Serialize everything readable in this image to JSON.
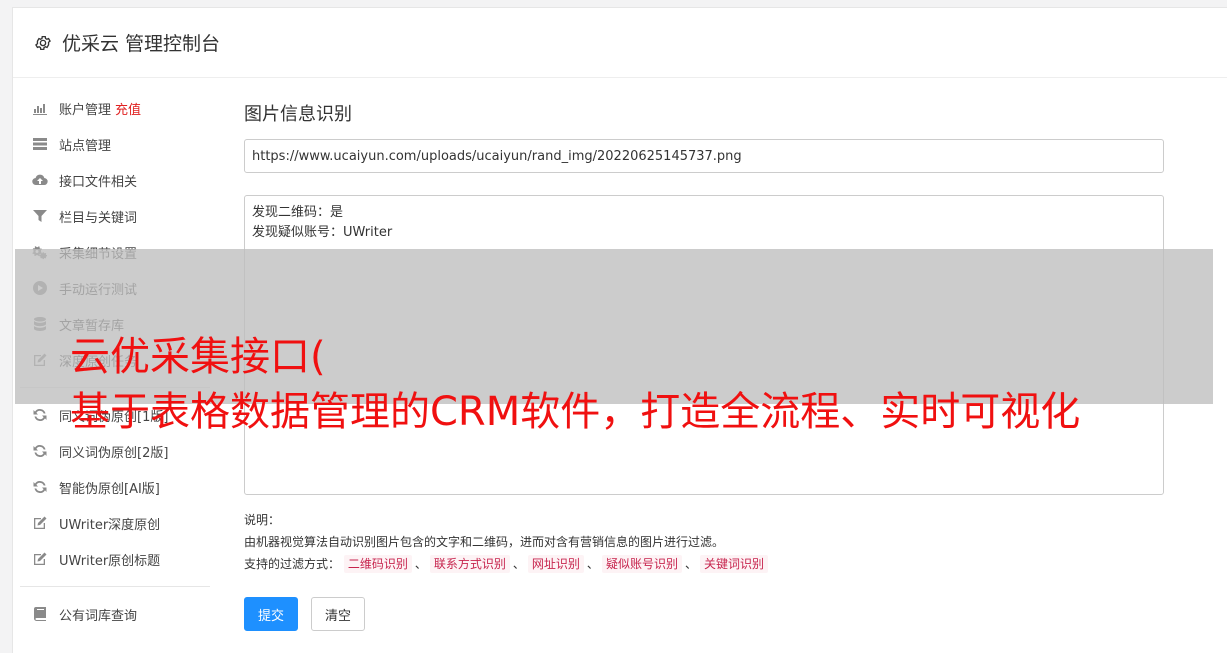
{
  "header": {
    "title": "优采云 管理控制台",
    "icon": "gear-icon"
  },
  "sidebar": {
    "group1": [
      {
        "label": "账户管理",
        "extra": "充值",
        "icon": "bar-chart-icon"
      },
      {
        "label": "站点管理",
        "icon": "server-icon"
      },
      {
        "label": "接口文件相关",
        "icon": "cloud-upload-icon"
      },
      {
        "label": "栏目与关键词",
        "icon": "filter-icon"
      },
      {
        "label": "采集细节设置",
        "icon": "cogs-icon"
      },
      {
        "label": "手动运行测试",
        "icon": "play-circle-icon"
      },
      {
        "label": "文章暂存库",
        "icon": "database-icon"
      },
      {
        "label": "深度原创任务",
        "icon": "edit-icon"
      }
    ],
    "group2": [
      {
        "label": "同义词伪原创[1版]",
        "icon": "refresh-icon"
      },
      {
        "label": "同义词伪原创[2版]",
        "icon": "refresh-icon"
      },
      {
        "label": "智能伪原创[AI版]",
        "icon": "refresh-icon"
      },
      {
        "label": "UWriter深度原创",
        "icon": "edit-icon"
      },
      {
        "label": "UWriter原创标题",
        "icon": "edit-icon"
      }
    ],
    "group3": [
      {
        "label": "公有词库查询",
        "icon": "book-icon"
      }
    ]
  },
  "main": {
    "title": "图片信息识别",
    "url_value": "https://www.ucaiyun.com/uploads/ucaiyun/rand_img/20220625145737.png",
    "result_lines": [
      "发现二维码：是",
      "发现疑似账号：UWriter"
    ],
    "desc_label": "说明：",
    "desc_text": "由机器视觉算法自动识别图片包含的文字和二维码，进而对含有营销信息的图片进行过滤。",
    "filters_label": "支持的过滤方式：",
    "filters": [
      "二维码识别",
      "联系方式识别",
      "网址识别",
      "疑似账号识别",
      "关键词识别"
    ],
    "filter_sep": "、",
    "submit_label": "提交",
    "clear_label": "清空"
  },
  "overlay": {
    "line1": "云优采集接口(",
    "line2": "基于表格数据管理的CRM软件，打造全流程、实时可视化"
  },
  "colors": {
    "primary": "#1e90ff",
    "recharge": "#e02020",
    "tag_text": "#c7254e",
    "overlay_text": "#f01010"
  }
}
